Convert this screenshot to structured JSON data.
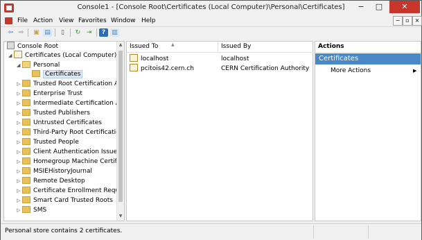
{
  "window": {
    "title": "Console1 - [Console Root\\Certificates (Local Computer)\\Personal\\Certificates]",
    "minimize_glyph": "−",
    "maximize_glyph": "□",
    "close_glyph": "✕"
  },
  "menu": {
    "items": [
      "File",
      "Action",
      "View",
      "Favorites",
      "Window",
      "Help"
    ],
    "mdi_glyphs": [
      "−",
      "▫",
      "×"
    ]
  },
  "toolbar": {
    "icons": [
      "back-arrow-icon",
      "forward-arrow-icon",
      "up-folder-icon",
      "show-hide-tree-icon",
      "copy-icon",
      "refresh-icon",
      "export-icon",
      "help-icon",
      "action-pane-icon"
    ],
    "glyphs": [
      "⇦",
      "⇨",
      "▣",
      "▤",
      "▯",
      "↻",
      "⇥",
      "?",
      "▥"
    ]
  },
  "tree": {
    "root": "Console Root",
    "computer": "Certificates (Local Computer)",
    "personal": "Personal",
    "selected": "Certificates",
    "stores": [
      "Trusted Root Certification Aut",
      "Enterprise Trust",
      "Intermediate Certification Aut",
      "Trusted Publishers",
      "Untrusted Certificates",
      "Third-Party Root Certification",
      "Trusted People",
      "Client Authentication Issuers",
      "Homegroup Machine Certifica",
      "MSIEHistoryJournal",
      "Remote Desktop",
      "Certificate Enrollment Reques",
      "Smart Card Trusted Roots",
      "SMS"
    ],
    "expanded_glyph": "◢",
    "collapsed_glyph": "▷",
    "scroll_up": "▲",
    "scroll_down": "▼"
  },
  "list": {
    "columns": [
      "Issued To",
      "Issued By"
    ],
    "sort_glyph": "▲",
    "rows": [
      {
        "issued_to": "localhost",
        "issued_by": "localhost"
      },
      {
        "issued_to": "pcitois42.cern.ch",
        "issued_by": "CERN Certification Authority"
      }
    ]
  },
  "actions": {
    "header": "Actions",
    "section": "Certificates",
    "item": "More Actions",
    "arrow": "▶"
  },
  "status": {
    "text": "Personal store contains 2 certificates."
  }
}
